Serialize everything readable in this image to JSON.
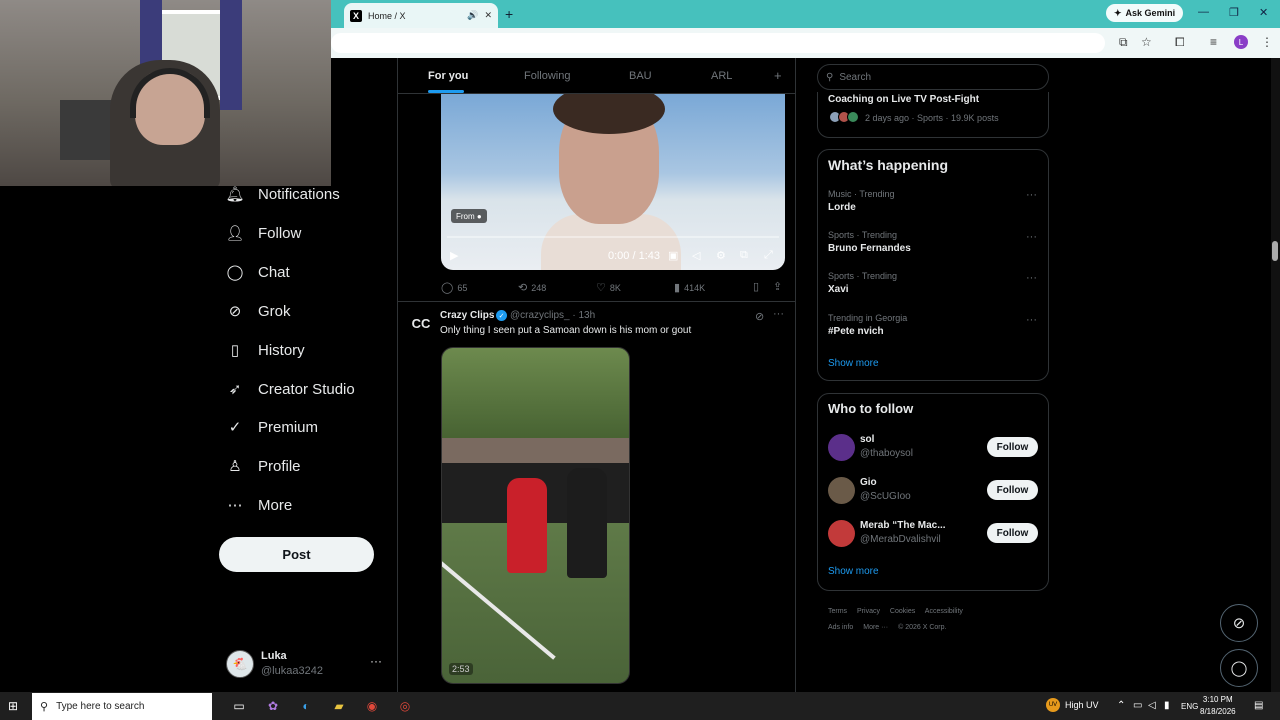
{
  "browser": {
    "tab_title": "Home / X",
    "tab_logo": "X",
    "new_tab": "+",
    "ask_gemini": "Ask Gemini",
    "profile_initial": "L"
  },
  "nav": {
    "items": [
      {
        "label": "Notifications",
        "icon": "bell-icon"
      },
      {
        "label": "Follow",
        "icon": "person-plus-icon"
      },
      {
        "label": "Chat",
        "icon": "chat-icon"
      },
      {
        "label": "Grok",
        "icon": "grok-icon"
      },
      {
        "label": "History",
        "icon": "bookmark-icon"
      },
      {
        "label": "Creator Studio",
        "icon": "rocket-icon"
      },
      {
        "label": "Premium",
        "icon": "verified-badge-icon"
      },
      {
        "label": "Profile",
        "icon": "person-icon"
      },
      {
        "label": "More",
        "icon": "more-circle-icon"
      }
    ],
    "post_label": "Post"
  },
  "user": {
    "name": "Luka",
    "handle": "@lukaa3242",
    "more": "···"
  },
  "feed": {
    "tabs": [
      "For you",
      "Following",
      "BAU",
      "ARL"
    ],
    "add_tab": "+",
    "video1": {
      "from_label": "From",
      "time": "0:00 / 1:43",
      "actions": {
        "replies": "65",
        "reposts": "248",
        "likes": "8K",
        "views": "414K"
      }
    },
    "post2": {
      "avatar_text": "CC",
      "author": "Crazy Clips",
      "handle": "@crazyclips_ · 13h",
      "text": "Only thing I seen put a Samoan down is his mom or gout",
      "duration": "2:53"
    }
  },
  "sidebar": {
    "search_placeholder": "Search",
    "top_trend": {
      "title": "Coaching on Live TV Post-Fight",
      "meta": "2 days ago · Sports · 19.9K posts"
    },
    "happening": {
      "title": "What’s happening",
      "trends": [
        {
          "category": "Music · Trending",
          "name": "Lorde"
        },
        {
          "category": "Sports · Trending",
          "name": "Bruno Fernandes"
        },
        {
          "category": "Sports · Trending",
          "name": "Xavi"
        },
        {
          "category": "Trending in Georgia",
          "name": "#Pete nvich"
        }
      ],
      "show_more": "Show more"
    },
    "who_to_follow": {
      "title": "Who to follow",
      "accounts": [
        {
          "name": "sol",
          "handle": "@thaboysol",
          "button": "Follow"
        },
        {
          "name": "Gio",
          "handle": "@ScUGIoo",
          "button": "Follow"
        },
        {
          "name": "Merab “The Mac...",
          "handle": "@MerabDvalishvil",
          "button": "Follow"
        }
      ],
      "show_more": "Show more"
    },
    "footer": {
      "links": [
        "Terms",
        "Privacy",
        "Cookies",
        "Accessibility",
        "Ads info",
        "More ···"
      ],
      "copyright": "© 2026 X Corp."
    }
  },
  "taskbar": {
    "search_placeholder": "Type here to search",
    "weather_badge": "UV",
    "weather_text": "High UV",
    "language": "ENG",
    "time": "3:10 PM",
    "date": "8/18/2026"
  },
  "colors": {
    "accent": "#1d9bf0",
    "browser_frame": "#46c1bd",
    "background": "#000000"
  }
}
